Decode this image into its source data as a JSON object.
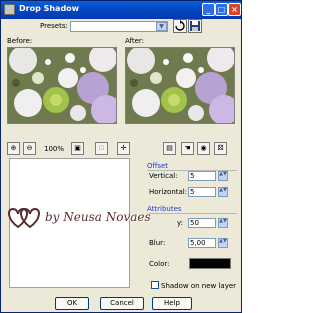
{
  "window": {
    "title": "Drop Shadow"
  },
  "presets": {
    "label": "Presets:",
    "value": ""
  },
  "previews": {
    "before_label": "Before:",
    "after_label": "After:"
  },
  "zoom": {
    "level": "100%"
  },
  "offset": {
    "header": "Offset",
    "vertical_label": "Vertical:",
    "vertical_value": "5",
    "horizontal_label": "Horizontal:",
    "horizontal_value": "5"
  },
  "attributes": {
    "header": "Attributes",
    "opacity_label": "y:",
    "opacity_value": "50",
    "blur_label": "Blur:",
    "blur_value": "5,00",
    "color_label": "Color:",
    "color_value": "#000000"
  },
  "shadow_on_new_layer": {
    "label": "Shadow on new layer",
    "checked": false
  },
  "buttons": {
    "ok": "OK",
    "cancel": "Cancel",
    "help": "Help"
  },
  "watermark": {
    "text": "by Neusa Novaes"
  },
  "icons": {
    "window": "drop-shadow-icon",
    "zoom_in": "zoom-in-icon",
    "zoom_out": "zoom-out-icon",
    "pan": "pan-icon",
    "save_preset": "save-icon",
    "reset": "reset-icon"
  }
}
